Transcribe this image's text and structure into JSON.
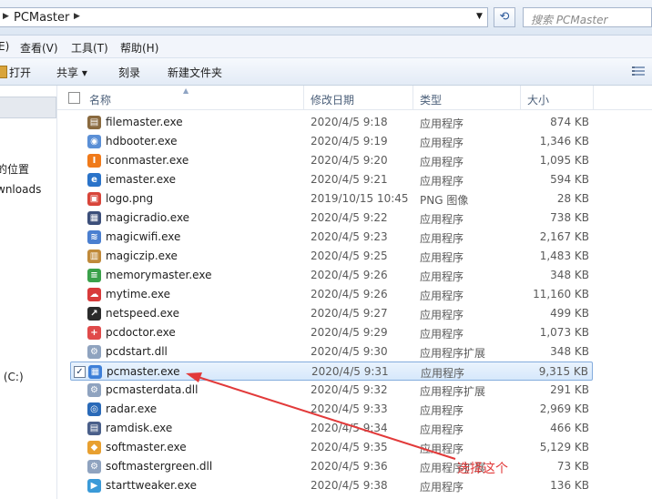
{
  "address": {
    "path": "PCMaster",
    "search_placeholder": "搜索 PCMaster"
  },
  "menu": [
    {
      "label": "E)",
      "name": "menu-edit"
    },
    {
      "label": "查看(V)",
      "name": "menu-view"
    },
    {
      "label": "工具(T)",
      "name": "menu-tools"
    },
    {
      "label": "帮助(H)",
      "name": "menu-help"
    }
  ],
  "toolbar": {
    "open": "打开",
    "share": "共享 ▾",
    "burn": "刻录",
    "new_folder": "新建文件夹"
  },
  "nav": {
    "items": [
      "的位置",
      "wnloads",
      ": (C:)",
      ")"
    ]
  },
  "columns": {
    "name": "名称",
    "date": "修改日期",
    "type": "类型",
    "size": "大小"
  },
  "files": [
    {
      "name": "filemaster.exe",
      "date": "2020/4/5 9:18",
      "type": "应用程序",
      "size": "874 KB",
      "icon": "filemaster-icon",
      "color": "#8a6a3f",
      "glyph": "▤"
    },
    {
      "name": "hdbooter.exe",
      "date": "2020/4/5 9:19",
      "type": "应用程序",
      "size": "1,346 KB",
      "icon": "hdbooter-icon",
      "color": "#5a8fd6",
      "glyph": "◉"
    },
    {
      "name": "iconmaster.exe",
      "date": "2020/4/5 9:20",
      "type": "应用程序",
      "size": "1,095 KB",
      "icon": "iconmaster-icon",
      "color": "#f07a1a",
      "glyph": "I"
    },
    {
      "name": "iemaster.exe",
      "date": "2020/4/5 9:21",
      "type": "应用程序",
      "size": "594 KB",
      "icon": "iemaster-icon",
      "color": "#2a73c9",
      "glyph": "e"
    },
    {
      "name": "logo.png",
      "date": "2019/10/15 10:45",
      "type": "PNG 图像",
      "size": "28 KB",
      "icon": "image-icon",
      "color": "#d8453a",
      "glyph": "▣"
    },
    {
      "name": "magicradio.exe",
      "date": "2020/4/5 9:22",
      "type": "应用程序",
      "size": "738 KB",
      "icon": "magicradio-icon",
      "color": "#3c4f7a",
      "glyph": "▦"
    },
    {
      "name": "magicwifi.exe",
      "date": "2020/4/5 9:23",
      "type": "应用程序",
      "size": "2,167 KB",
      "icon": "magicwifi-icon",
      "color": "#4a7fd0",
      "glyph": "≋"
    },
    {
      "name": "magiczip.exe",
      "date": "2020/4/5 9:25",
      "type": "应用程序",
      "size": "1,483 KB",
      "icon": "magiczip-icon",
      "color": "#c08a3a",
      "glyph": "▥"
    },
    {
      "name": "memorymaster.exe",
      "date": "2020/4/5 9:26",
      "type": "应用程序",
      "size": "348 KB",
      "icon": "memorymaster-icon",
      "color": "#3aa14a",
      "glyph": "≡"
    },
    {
      "name": "mytime.exe",
      "date": "2020/4/5 9:26",
      "type": "应用程序",
      "size": "11,160 KB",
      "icon": "mytime-icon",
      "color": "#d83a3a",
      "glyph": "☁"
    },
    {
      "name": "netspeed.exe",
      "date": "2020/4/5 9:27",
      "type": "应用程序",
      "size": "499 KB",
      "icon": "netspeed-icon",
      "color": "#2b2b2b",
      "glyph": "↗"
    },
    {
      "name": "pcdoctor.exe",
      "date": "2020/4/5 9:29",
      "type": "应用程序",
      "size": "1,073 KB",
      "icon": "pcdoctor-icon",
      "color": "#e04a4a",
      "glyph": "+"
    },
    {
      "name": "pcdstart.dll",
      "date": "2020/4/5 9:30",
      "type": "应用程序扩展",
      "size": "348 KB",
      "icon": "dll-icon",
      "color": "#8fa3bf",
      "glyph": "⚙"
    },
    {
      "name": "pcmaster.exe",
      "date": "2020/4/5 9:31",
      "type": "应用程序",
      "size": "9,315 KB",
      "icon": "pcmaster-icon",
      "color": "#3d7fd8",
      "glyph": "▦",
      "selected": true
    },
    {
      "name": "pcmasterdata.dll",
      "date": "2020/4/5 9:32",
      "type": "应用程序扩展",
      "size": "291 KB",
      "icon": "dll-icon",
      "color": "#8fa3bf",
      "glyph": "⚙"
    },
    {
      "name": "radar.exe",
      "date": "2020/4/5 9:33",
      "type": "应用程序",
      "size": "2,969 KB",
      "icon": "radar-icon",
      "color": "#2a6ab8",
      "glyph": "◎"
    },
    {
      "name": "ramdisk.exe",
      "date": "2020/4/5 9:34",
      "type": "应用程序",
      "size": "466 KB",
      "icon": "ramdisk-icon",
      "color": "#4a5f8a",
      "glyph": "▤"
    },
    {
      "name": "softmaster.exe",
      "date": "2020/4/5 9:35",
      "type": "应用程序",
      "size": "5,129 KB",
      "icon": "softmaster-icon",
      "color": "#e8a030",
      "glyph": "◆"
    },
    {
      "name": "softmastergreen.dll",
      "date": "2020/4/5 9:36",
      "type": "应用程序扩展",
      "size": "73 KB",
      "icon": "dll-icon",
      "color": "#8fa3bf",
      "glyph": "⚙"
    },
    {
      "name": "starttweaker.exe",
      "date": "2020/4/5 9:38",
      "type": "应用程序",
      "size": "136 KB",
      "icon": "starttweaker-icon",
      "color": "#3a9ad8",
      "glyph": "▶"
    }
  ],
  "annotation": {
    "text": "选择这个",
    "color": "#e23a3a"
  }
}
